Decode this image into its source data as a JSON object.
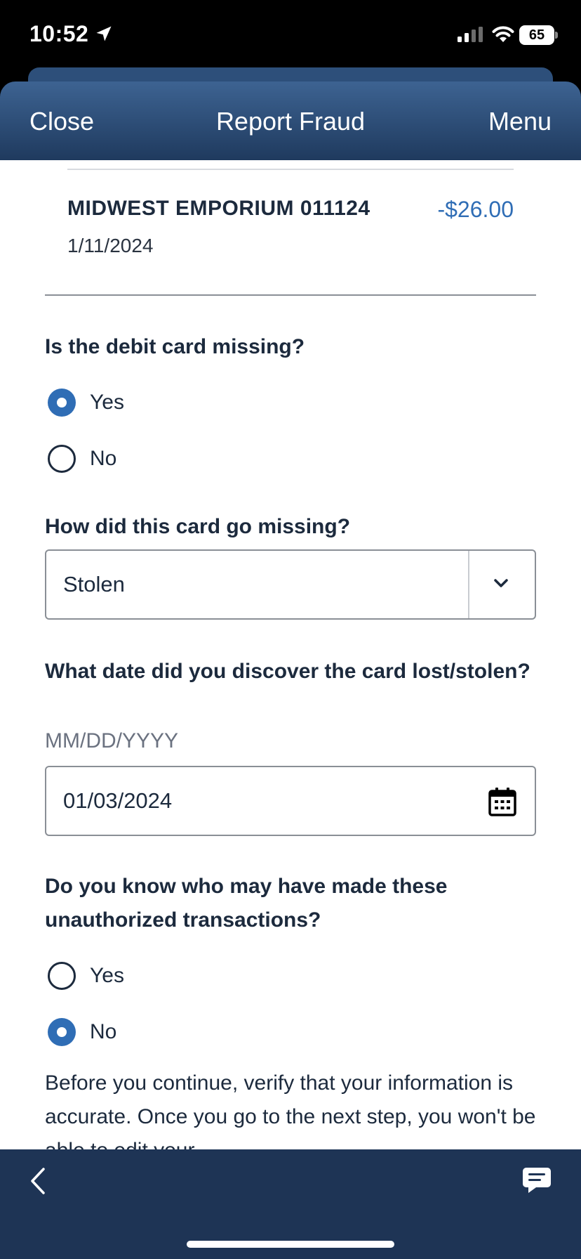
{
  "status_bar": {
    "time": "10:52",
    "battery": "65"
  },
  "header": {
    "close_label": "Close",
    "title": "Report Fraud",
    "menu_label": "Menu"
  },
  "transaction": {
    "merchant": "MIDWEST EMPORIUM 011124",
    "amount": "-$26.00",
    "date": "1/11/2024"
  },
  "q_card_missing": {
    "label": "Is the debit card missing?",
    "options": [
      {
        "label": "Yes",
        "selected": true
      },
      {
        "label": "No",
        "selected": false
      }
    ]
  },
  "q_how_missing": {
    "label": "How did this card go missing?",
    "selected_value": "Stolen"
  },
  "q_discover_date": {
    "label": "What date did you discover the card lost/stolen?",
    "hint": "MM/DD/YYYY",
    "value": "01/03/2024"
  },
  "q_know_who": {
    "label": "Do you know who may have made these unauthorized transactions?",
    "options": [
      {
        "label": "Yes",
        "selected": false
      },
      {
        "label": "No",
        "selected": true
      }
    ]
  },
  "notice": "Before you continue, verify that your information is accurate. Once you go to the next step, you won't be able to edit your",
  "icons": {
    "back": "chevron-left-icon",
    "chat": "chat-bubble-icon",
    "calendar": "calendar-icon",
    "dropdown": "chevron-down-icon"
  },
  "colors": {
    "header_top": "#3d6392",
    "header_bottom": "#1f3a5e",
    "accent": "#2f6db5",
    "bottom_bar": "#1e3455"
  }
}
